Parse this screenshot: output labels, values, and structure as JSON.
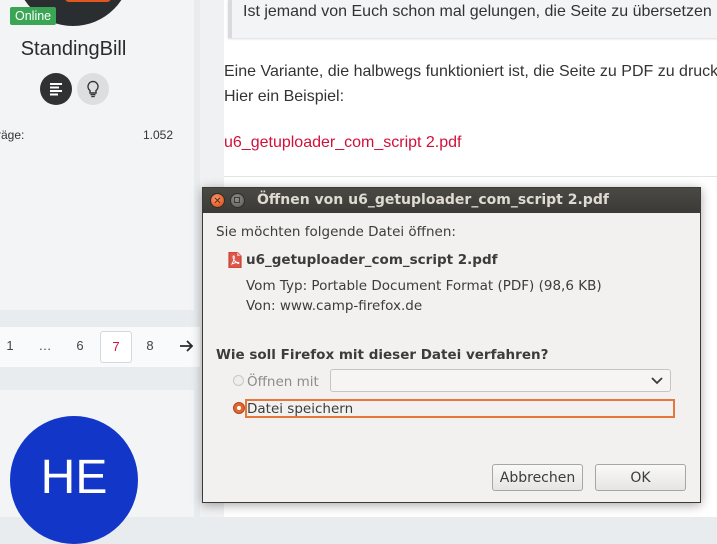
{
  "sidebar": {
    "online_badge": "Online",
    "username": "StandingBill",
    "posts_label": "räge:",
    "posts_count": "1.052",
    "second_avatar_initials": "HE"
  },
  "pagination": {
    "items": [
      "1",
      "…",
      "6",
      "7",
      "8"
    ],
    "current": "7",
    "next_icon": "arrow-right-icon"
  },
  "post": {
    "quote_text": "Ist jemand von Euch schon mal gelungen, die Seite zu übersetzen",
    "paragraph_line1": "Eine Variante, die halbwegs funktioniert ist, die Seite zu PDF zu drucken",
    "paragraph_line2": "Hier ein Beispiel:",
    "link_text": "u6_getuploader_com_script 2.pdf",
    "link_color": "#d0103a"
  },
  "dialog": {
    "title": "Öffnen von u6_getuploader_com_script 2.pdf",
    "intro": "Sie möchten folgende Datei öffnen:",
    "filename": "u6_getuploader_com_script 2.pdf",
    "type_line": "Vom Typ: Portable Document Format (PDF) (98,6 KB)",
    "from_line": "Von: www.camp-firefox.de",
    "question": "Wie soll Firefox mit dieser Datei verfahren?",
    "open_with_label": "Öffnen mit",
    "open_with_value": "",
    "save_label": "Datei speichern",
    "selected_option": "save",
    "cancel_label": "Abbrechen",
    "ok_label": "OK",
    "accent_color": "#e5652d"
  }
}
